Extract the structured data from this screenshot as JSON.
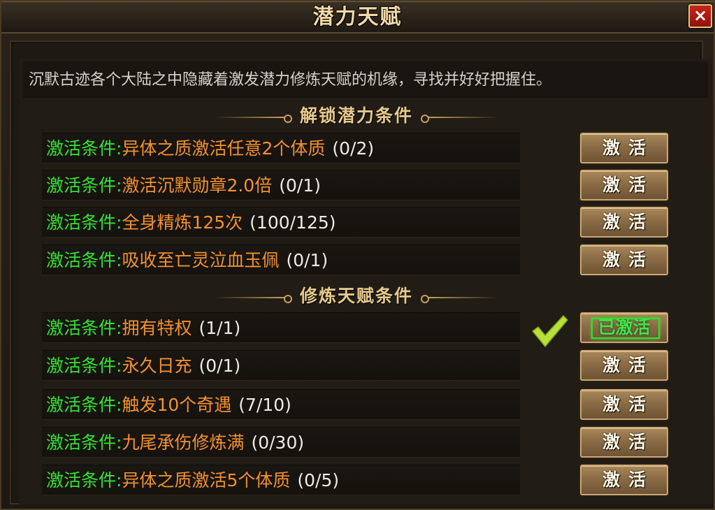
{
  "window": {
    "title": "潜力天赋",
    "close_icon": "×",
    "intro": "沉默古迹各个大陆之中隐藏着激发潜力修炼天赋的机缘，寻找并好好把握住。"
  },
  "sections": [
    {
      "title": "解锁潜力条件",
      "rows": [
        {
          "label": "激活条件:",
          "condition": "异体之质激活任意2个体质",
          "progress": "(0/2)",
          "button": "激活"
        },
        {
          "label": "激活条件:",
          "condition": "激活沉默勋章2.0倍",
          "progress": "(0/1)",
          "button": "激活"
        },
        {
          "label": "激活条件:",
          "condition": "全身精炼125次",
          "progress": "(100/125)",
          "button": "激活"
        },
        {
          "label": "激活条件:",
          "condition": "吸收至亡灵泣血玉佩",
          "progress": "(0/1)",
          "button": "激活"
        }
      ]
    },
    {
      "title": "修炼天赋条件",
      "rows": [
        {
          "label": "激活条件:",
          "condition": "拥有特权",
          "progress": "(1/1)",
          "button": "已激活",
          "activated": true
        },
        {
          "label": "激活条件:",
          "condition": "永久日充",
          "progress": "(0/1)",
          "button": "激活"
        },
        {
          "label": "激活条件:",
          "condition": "触发10个奇遇",
          "progress": "(7/10)",
          "button": "激活"
        },
        {
          "label": "激活条件:",
          "condition": "九尾承伤修炼满",
          "progress": "(0/30)",
          "button": "激活"
        },
        {
          "label": "激活条件:",
          "condition": "异体之质激活5个体质",
          "progress": "(0/5)",
          "button": "激活"
        }
      ]
    }
  ],
  "colors": {
    "label": "#33e233",
    "condition": "#f2912e",
    "progress": "#ecebe6",
    "header": "#e6c98c",
    "check": "#b6e03a"
  }
}
